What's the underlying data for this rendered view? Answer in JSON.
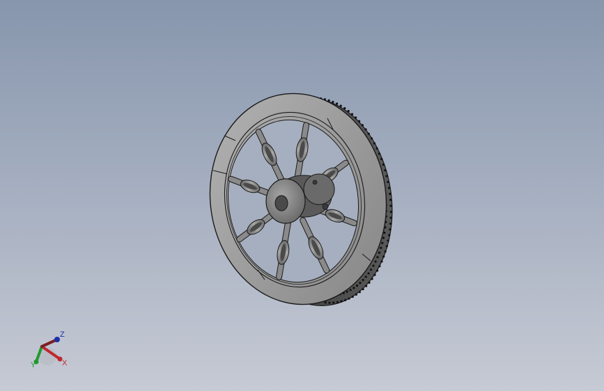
{
  "viewport": {
    "background_top": "#8796ad",
    "background_bottom": "#c6cad4"
  },
  "model": {
    "body_color": "#9a9a9a",
    "shadow_color": "#5f5f5f",
    "edge_color": "#1a1a1a",
    "spoke_count": 8,
    "bolt_hole_icon": "bolt-hole-icon"
  },
  "triad": {
    "x_label": "X",
    "y_label": "Y",
    "z_label": "Z",
    "x_color": "#c0282d",
    "y_color": "#1e9a2e",
    "z_color": "#1c2fa8"
  }
}
